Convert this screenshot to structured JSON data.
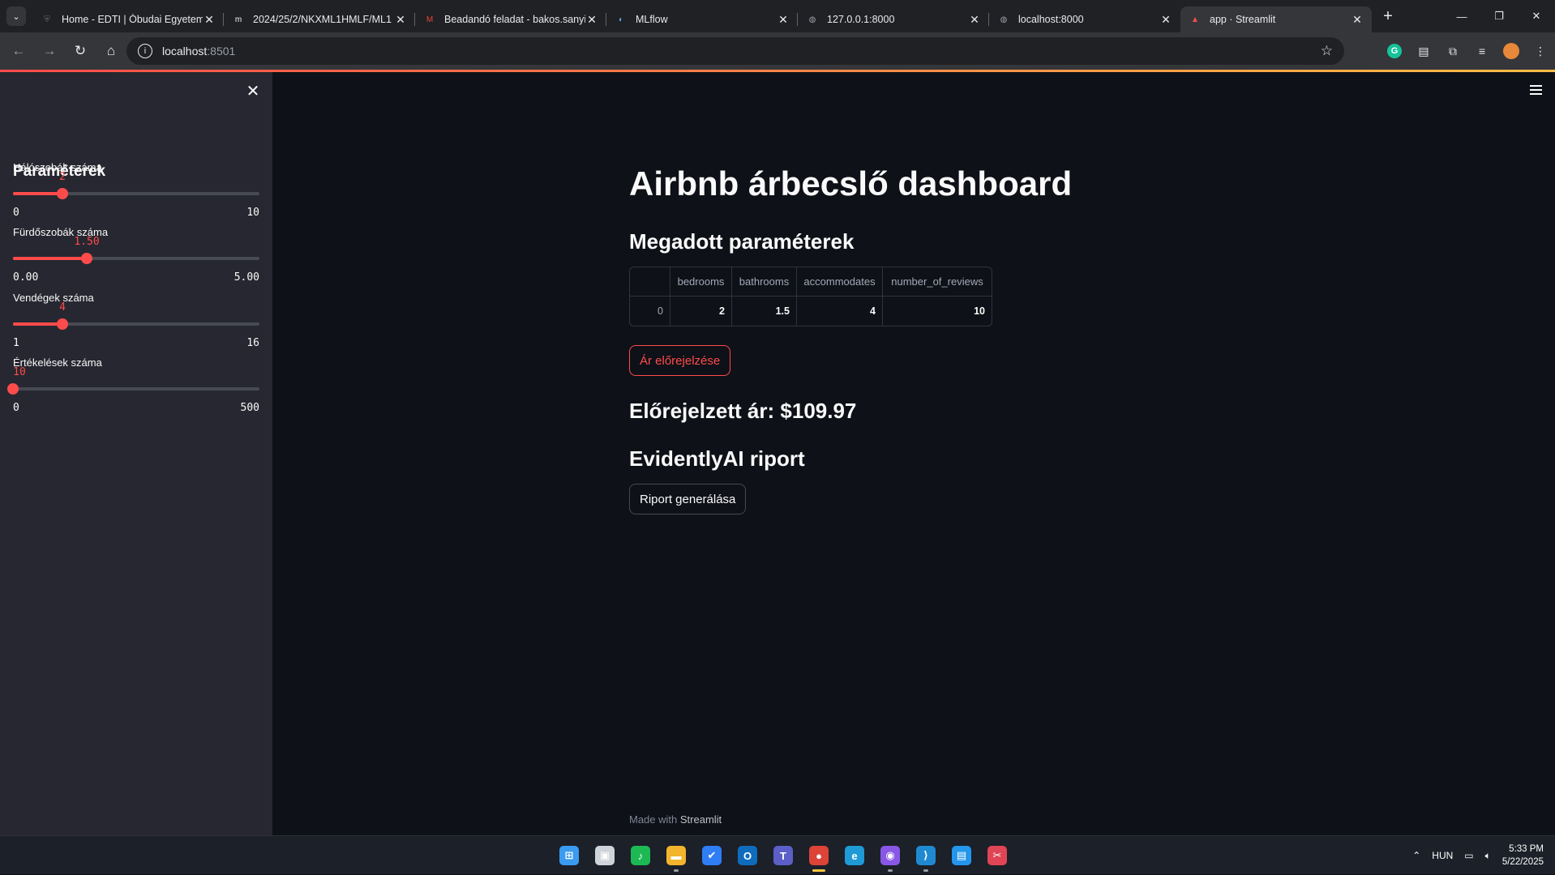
{
  "browser": {
    "tabs": [
      {
        "title": "Home - EDTI | Óbudai Egyetem",
        "icon": "university-icon",
        "color": "#5f6368"
      },
      {
        "title": "2024/25/2/NKXML1HMLF/ML1",
        "icon": "moodle-icon",
        "color": "#f5f5f5"
      },
      {
        "title": "Beadandó feladat - bakos.sanyi",
        "icon": "gmail-icon",
        "color": "#ea4335"
      },
      {
        "title": "MLflow",
        "icon": "mlflow-icon",
        "color": "#4fa0f0"
      },
      {
        "title": "127.0.0.1:8000",
        "icon": "globe-icon",
        "color": "#9aa0a6"
      },
      {
        "title": "localhost:8000",
        "icon": "globe-icon",
        "color": "#9aa0a6"
      },
      {
        "title": "app · Streamlit",
        "icon": "streamlit-icon",
        "color": "#ff4b4b"
      }
    ],
    "url_host": "localhost",
    "url_port": ":8501"
  },
  "sidebar": {
    "title": "Paraméterek",
    "sliders": [
      {
        "label": "Hálószobák száma",
        "value": "2",
        "min": "0",
        "max": "10",
        "fraction": 0.2
      },
      {
        "label": "Fürdőszobák száma",
        "value": "1.50",
        "min": "0.00",
        "max": "5.00",
        "fraction": 0.3
      },
      {
        "label": "Vendégek száma",
        "value": "4",
        "min": "1",
        "max": "16",
        "fraction": 0.2
      },
      {
        "label": "Értékelések száma",
        "value": "10",
        "min": "0",
        "max": "500",
        "fraction": 0.0
      }
    ]
  },
  "main": {
    "title": "Airbnb árbecslő dashboard",
    "params_header": "Megadott paraméterek",
    "table": {
      "columns": [
        "",
        "bedrooms",
        "bathrooms",
        "accommodates",
        "number_of_reviews"
      ],
      "rows": [
        [
          "0",
          "2",
          "1.5",
          "4",
          "10"
        ]
      ]
    },
    "predict_button": "Ár előrejelzése",
    "prediction": "Előrejelzett ár: $109.97",
    "evidently_header": "EvidentlyAI riport",
    "report_button": "Riport generálása",
    "footer_prefix": "Made with ",
    "footer_brand": "Streamlit"
  },
  "taskbar": {
    "language": "HUN",
    "time": "5:33 PM",
    "date": "5/22/2025",
    "apps": [
      {
        "name": "windows-start-icon",
        "color": "#3a9bf0",
        "glyph": "⊞"
      },
      {
        "name": "task-view-icon",
        "color": "#cfd3da",
        "glyph": "▣"
      },
      {
        "name": "spotify-icon",
        "color": "#1db954",
        "glyph": "♪"
      },
      {
        "name": "file-explorer-icon",
        "color": "#f3b52c",
        "glyph": "▬"
      },
      {
        "name": "todo-icon",
        "color": "#2f7ef5",
        "glyph": "✔"
      },
      {
        "name": "outlook-icon",
        "color": "#0f6cbd",
        "glyph": "O"
      },
      {
        "name": "teams-icon",
        "color": "#5b5fc7",
        "glyph": "T"
      },
      {
        "name": "chrome-icon",
        "color": "#db4437",
        "glyph": "●"
      },
      {
        "name": "edge-icon",
        "color": "#1f9ad6",
        "glyph": "e"
      },
      {
        "name": "github-desktop-icon",
        "color": "#8957e5",
        "glyph": "◉"
      },
      {
        "name": "vscode-icon",
        "color": "#1f8ad2",
        "glyph": "⟩"
      },
      {
        "name": "docker-icon",
        "color": "#2496ed",
        "glyph": "▤"
      },
      {
        "name": "snipping-tool-icon",
        "color": "#e04555",
        "glyph": "✂"
      }
    ]
  }
}
